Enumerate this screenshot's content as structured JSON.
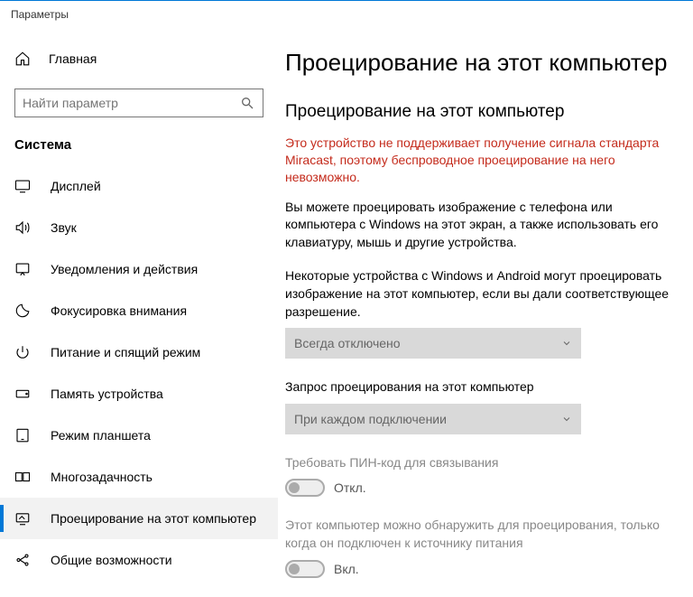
{
  "window": {
    "title": "Параметры"
  },
  "sidebar": {
    "home": "Главная",
    "search_placeholder": "Найти параметр",
    "group": "Система",
    "items": [
      {
        "icon": "display-icon",
        "label": "Дисплей"
      },
      {
        "icon": "sound-icon",
        "label": "Звук"
      },
      {
        "icon": "notifications-icon",
        "label": "Уведомления и действия"
      },
      {
        "icon": "focus-icon",
        "label": "Фокусировка внимания"
      },
      {
        "icon": "power-icon",
        "label": "Питание и спящий режим"
      },
      {
        "icon": "storage-icon",
        "label": "Память устройства"
      },
      {
        "icon": "tablet-icon",
        "label": "Режим планшета"
      },
      {
        "icon": "multitask-icon",
        "label": "Многозадачность"
      },
      {
        "icon": "project-icon",
        "label": "Проецирование на этот компьютер"
      },
      {
        "icon": "shared-icon",
        "label": "Общие возможности"
      }
    ],
    "selected_index": 8
  },
  "content": {
    "title": "Проецирование на этот компьютер",
    "section": "Проецирование на этот компьютер",
    "warning": "Это устройство не поддерживает получение сигнала стандарта Miracast, поэтому беспроводное проецирование на него невозможно.",
    "intro": "Вы можете проецировать изображение с телефона или компьютера с Windows на этот экран, а также использовать его клавиатуру, мышь и другие устройства.",
    "setting1_label": "Некоторые устройства с Windows и Android могут проецировать изображение на этот компьютер, если вы дали соответствующее разрешение.",
    "setting1_value": "Всегда отключено",
    "setting2_label": "Запрос проецирования на этот компьютер",
    "setting2_value": "При каждом подключении",
    "setting3_label": "Требовать ПИН-код для связывания",
    "setting3_state": "Откл.",
    "setting4_label": "Этот компьютер можно обнаружить для проецирования, только когда он подключен к источнику питания",
    "setting4_state": "Вкл."
  }
}
